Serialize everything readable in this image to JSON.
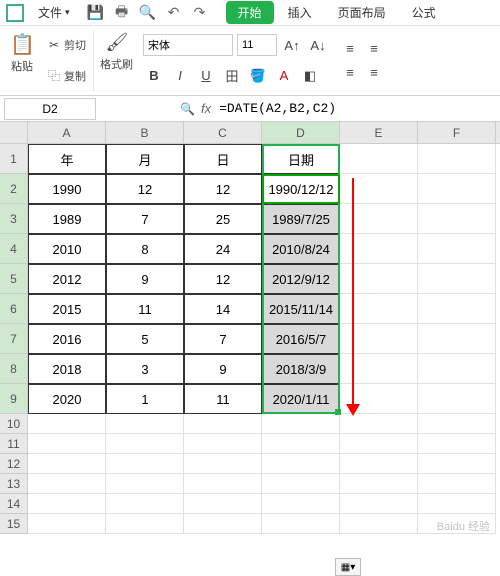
{
  "menu": {
    "file_label": "文件",
    "arrow": "▾"
  },
  "tabs": {
    "start": "开始",
    "insert": "插入",
    "layout": "页面布局",
    "formula": "公式"
  },
  "ribbon": {
    "cut": "剪切",
    "copy": "复制",
    "paste": "粘贴",
    "painter": "格式刷",
    "font_name": "宋体",
    "font_size": "11"
  },
  "name_box": "D2",
  "formula": "=DATE(A2,B2,C2)",
  "columns": [
    "A",
    "B",
    "C",
    "D",
    "E",
    "F"
  ],
  "headers": {
    "A": "年",
    "B": "月",
    "C": "日",
    "D": "日期"
  },
  "rows": [
    {
      "n": 1,
      "A": "年",
      "B": "月",
      "C": "日",
      "D": "日期"
    },
    {
      "n": 2,
      "A": "1990",
      "B": "12",
      "C": "12",
      "D": "1990/12/12"
    },
    {
      "n": 3,
      "A": "1989",
      "B": "7",
      "C": "25",
      "D": "1989/7/25"
    },
    {
      "n": 4,
      "A": "2010",
      "B": "8",
      "C": "24",
      "D": "2010/8/24"
    },
    {
      "n": 5,
      "A": "2012",
      "B": "9",
      "C": "12",
      "D": "2012/9/12"
    },
    {
      "n": 6,
      "A": "2015",
      "B": "11",
      "C": "14",
      "D": "2015/11/14"
    },
    {
      "n": 7,
      "A": "2016",
      "B": "5",
      "C": "7",
      "D": "2016/5/7"
    },
    {
      "n": 8,
      "A": "2018",
      "B": "3",
      "C": "9",
      "D": "2018/3/9"
    },
    {
      "n": 9,
      "A": "2020",
      "B": "1",
      "C": "11",
      "D": "2020/1/11"
    }
  ],
  "paste_options_label": "▦▾",
  "watermark": "Baidu 经验"
}
